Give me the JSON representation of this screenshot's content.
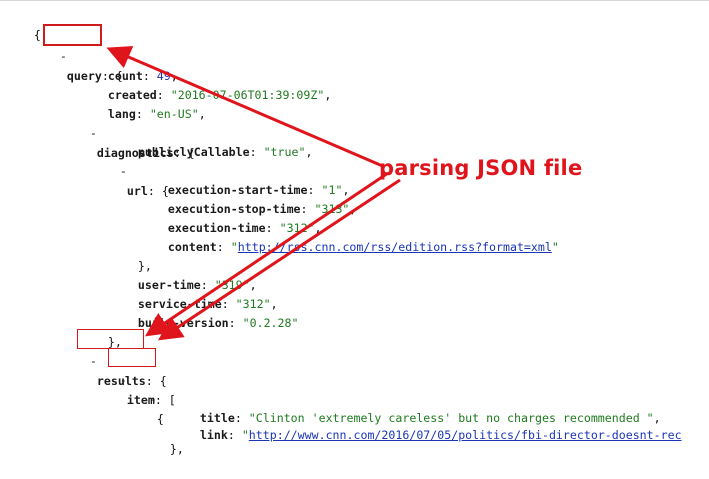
{
  "json_viewer": {
    "lines": [
      {
        "toggle": "",
        "text": "{"
      },
      {
        "toggle": "-",
        "key": "query",
        "sep": ": ",
        "text": "{"
      },
      {
        "key": "count",
        "sep": ": ",
        "value": "49",
        "vtype": "num",
        "trail": ","
      },
      {
        "key": "created",
        "sep": ": ",
        "value": "\"2016-07-06T01:39:09Z\"",
        "vtype": "str",
        "trail": ","
      },
      {
        "key": "lang",
        "sep": ": ",
        "value": "\"en-US\"",
        "vtype": "str",
        "trail": ","
      },
      {
        "toggle": "-",
        "key": "diagnostics",
        "sep": ": ",
        "text": "{"
      },
      {
        "key": "publiclyCallable",
        "sep": ": ",
        "value": "\"true\"",
        "vtype": "str",
        "trail": ","
      },
      {
        "toggle": "-",
        "key": "url",
        "sep": ": ",
        "text": "{"
      },
      {
        "key": "execution-start-time",
        "sep": ": ",
        "value": "\"1\"",
        "vtype": "str",
        "trail": ","
      },
      {
        "key": "execution-stop-time",
        "sep": ": ",
        "value": "\"313\"",
        "vtype": "str",
        "trail": ","
      },
      {
        "key": "execution-time",
        "sep": ": ",
        "value": "\"312\"",
        "vtype": "str",
        "trail": ","
      },
      {
        "key": "content",
        "sep": ": ",
        "quote": "\"",
        "value": "http://rss.cnn.com/rss/edition.rss?format=xml",
        "vtype": "lnk",
        "trail": "\""
      },
      {
        "text": "},"
      },
      {
        "key": "user-time",
        "sep": ": ",
        "value": "\"319\"",
        "vtype": "str",
        "trail": ","
      },
      {
        "key": "service-time",
        "sep": ": ",
        "value": "\"312\"",
        "vtype": "str",
        "trail": ","
      },
      {
        "key": "build-version",
        "sep": ": ",
        "value": "\"0.2.28\"",
        "vtype": "str",
        "trail": ""
      },
      {
        "text": "},"
      },
      {
        "toggle": "-",
        "key": "results",
        "sep": ": ",
        "text": "{"
      },
      {
        "toggle": "-",
        "key": "item",
        "sep": ": ",
        "text": "["
      },
      {
        "toggle": "-",
        "text": "{"
      },
      {
        "key": "title",
        "sep": ": ",
        "value": "\"Clinton 'extremely careless' but no charges recommended \"",
        "vtype": "str",
        "trail": ","
      },
      {
        "key": "link",
        "sep": ": ",
        "quote": "\"",
        "value": "http://www.cnn.com/2016/07/05/politics/fbi-director-doesnt-rec",
        "vtype": "lnk",
        "trail": ""
      },
      {
        "text": "},"
      }
    ]
  },
  "annotation": {
    "label": "parsing JSON file",
    "color": "#e0141b"
  }
}
